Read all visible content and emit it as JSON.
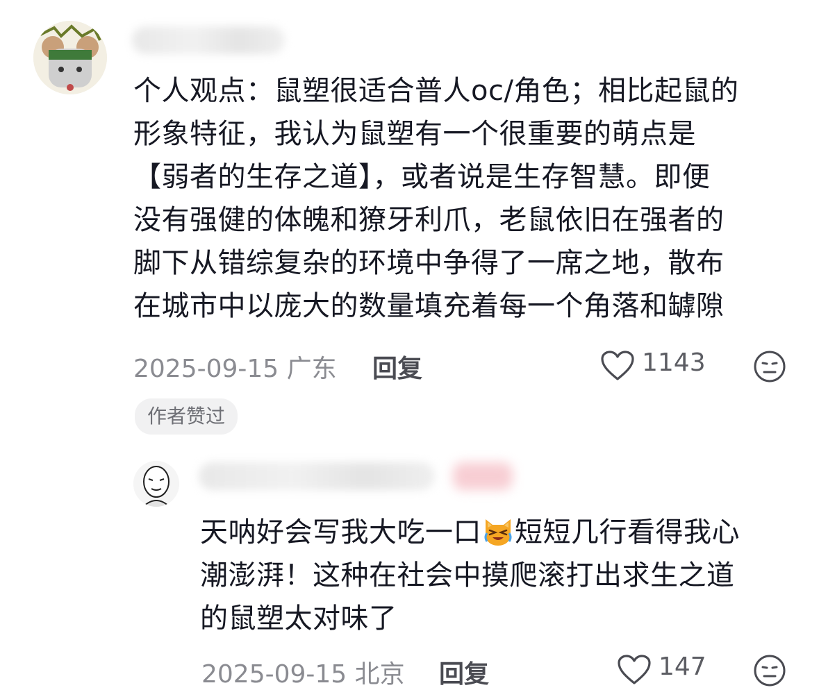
{
  "comments": [
    {
      "lines": [
        "个人观点：鼠塑很适合普人oc/角色；相比起鼠的",
        "形象特征，我认为鼠塑有一个很重要的萌点是",
        "【弱者的生存之道】，或者说是生存智慧。即便",
        "没有强健的体魄和獠牙利爪，老鼠依旧在强者的",
        "脚下从错综复杂的环境中争得了一席之地，散布",
        "在城市中以庞大的数量填充着每一个角落和罅隙"
      ],
      "date_location": "2025-09-15 广东",
      "reply_label": "回复",
      "like_count": "1143",
      "badge": "作者赞过",
      "icons": {
        "like": "heart-outline-icon",
        "react": "meh-face-icon"
      }
    },
    {
      "line1_before": "天呐好会写我大吃一口",
      "line1_after": "短短几行看得我心",
      "line2": "潮澎湃！这种在社会中摸爬滚打出求生之道",
      "line3": "的鼠塑太对味了",
      "date_location": "2025-09-15 北京",
      "reply_label": "回复",
      "like_count": "147",
      "icons": {
        "emoji": "crying-cat-emoji",
        "like": "heart-outline-icon",
        "react": "meh-face-icon"
      }
    }
  ],
  "colors": {
    "text": "#161823",
    "meta": "#8a8b91",
    "badge_bg": "#f1f1f2"
  }
}
